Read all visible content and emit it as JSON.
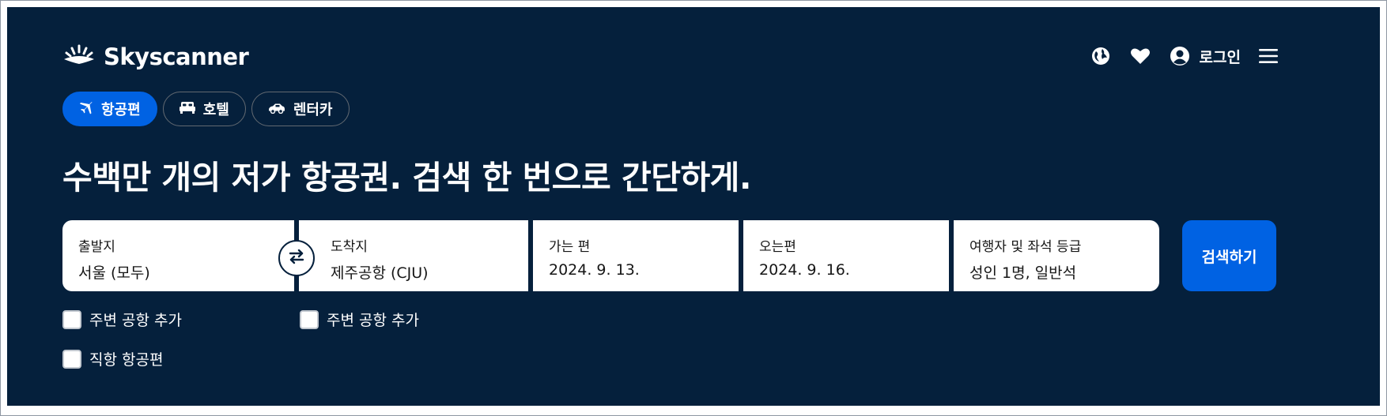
{
  "brand": {
    "name": "Skyscanner",
    "logo_icon": "sunrise-logo-icon"
  },
  "header": {
    "language_icon": "globe-icon",
    "favorites_icon": "heart-icon",
    "account_icon": "user-circle-icon",
    "login_label": "로그인",
    "menu_icon": "hamburger-menu-icon"
  },
  "tabs": [
    {
      "label": "항공편",
      "icon": "airplane-icon",
      "active": true
    },
    {
      "label": "호텔",
      "icon": "bed-icon",
      "active": false
    },
    {
      "label": "렌터카",
      "icon": "car-icon",
      "active": false
    }
  ],
  "headline": "수백만 개의 저가 항공권. 검색 한 번으로 간단하게.",
  "search": {
    "origin": {
      "label": "출발지",
      "value": "서울 (모두)"
    },
    "destination": {
      "label": "도착지",
      "value": "제주공항 (CJU)"
    },
    "depart": {
      "label": "가는 편",
      "value": "2024. 9. 13."
    },
    "return": {
      "label": "오는편",
      "value": "2024. 9. 16."
    },
    "travellers": {
      "label": "여행자 및 좌석 등급",
      "value": "성인 1명, 일반석"
    },
    "swap_icon": "swap-arrows-icon",
    "button_label": "검색하기"
  },
  "options": {
    "nearby_origin": {
      "label": "주변 공항 추가",
      "checked": false
    },
    "nearby_destination": {
      "label": "주변 공항 추가",
      "checked": false
    },
    "direct_flights": {
      "label": "직항 항공편",
      "checked": false
    }
  },
  "colors": {
    "background": "#05203c",
    "accent": "#0062e3",
    "text_light": "#ffffff",
    "text_dark": "#161616"
  }
}
